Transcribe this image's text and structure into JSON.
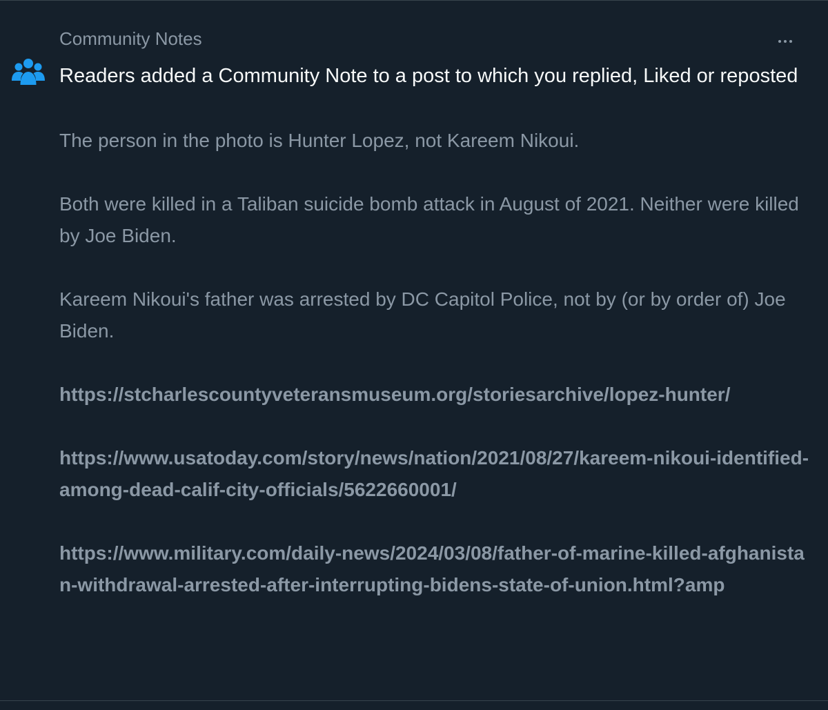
{
  "notification": {
    "header_label": "Community Notes",
    "headline": "Readers added a Community Note to a post to which you replied, Liked or reposted",
    "icon": "people-group-icon",
    "more_icon": "more-options-icon",
    "accent_color": "#1d9bf0"
  },
  "note": {
    "paragraphs": [
      "The person in the photo is Hunter Lopez, not Kareem Nikoui.",
      "Both were killed in a Taliban suicide bomb attack in August of 2021. Neither were killed by Joe Biden.",
      "Kareem Nikoui's father was arrested by DC Capitol Police, not by (or by order of) Joe Biden."
    ],
    "links": [
      "https://stcharlescountyveteransmuseum.org/storiesarchive/lopez-hunter/",
      "https://www.usatoday.com/story/news/nation/2021/08/27/kareem-nikoui-identified-among-dead-calif-city-officials/5622660001/",
      "https://www.military.com/daily-news/2024/03/08/father-of-marine-killed-afghanistan-withdrawal-arrested-after-interrupting-bidens-state-of-union.html?amp"
    ]
  }
}
